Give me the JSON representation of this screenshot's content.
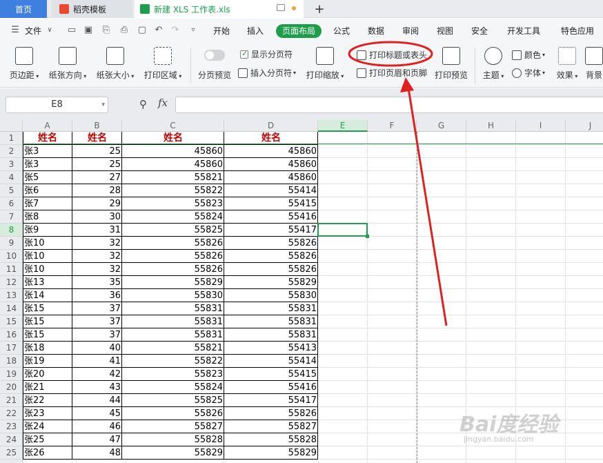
{
  "tabs": {
    "home": "首页",
    "docer": "稻壳模板",
    "file": "新建 XLS 工作表.xls",
    "add": "+"
  },
  "menu": {
    "file": "文件",
    "items": [
      "开始",
      "插入",
      "页面布局",
      "公式",
      "数据",
      "审阅",
      "视图",
      "安全",
      "开发工具",
      "特色应用"
    ],
    "active_index": 2
  },
  "ribbon": {
    "margins": "页边距",
    "orientation": "纸张方向",
    "size": "纸张大小",
    "print_area": "打印区域",
    "page_break_preview": "分页预览",
    "show_page_breaks": "显示分页符",
    "insert_page_break": "插入分页符",
    "print_scaling": "打印缩放",
    "print_titles": "打印标题或表头",
    "print_header_footer": "打印页眉和页脚",
    "print_preview": "打印预览",
    "theme": "主题",
    "colors": "颜色",
    "fonts": "字体",
    "effects": "效果",
    "background": "背景"
  },
  "formula_bar": {
    "cell_ref": "E8",
    "fx": "fx",
    "value": ""
  },
  "columns": [
    "A",
    "B",
    "C",
    "D",
    "E",
    "F",
    "G",
    "H",
    "I",
    "J"
  ],
  "active_column": "E",
  "active_row": 8,
  "header_row": [
    "姓名",
    "姓名",
    "姓名",
    "姓名"
  ],
  "rows": [
    [
      "张3",
      "25",
      "45860",
      "45860"
    ],
    [
      "张3",
      "25",
      "45860",
      "45860"
    ],
    [
      "张5",
      "27",
      "55821",
      "45860"
    ],
    [
      "张6",
      "28",
      "55822",
      "55414"
    ],
    [
      "张7",
      "29",
      "55823",
      "55415"
    ],
    [
      "张8",
      "30",
      "55824",
      "55416"
    ],
    [
      "张9",
      "31",
      "55825",
      "55417"
    ],
    [
      "张10",
      "32",
      "55826",
      "55826"
    ],
    [
      "张10",
      "32",
      "55826",
      "55826"
    ],
    [
      "张10",
      "32",
      "55826",
      "55826"
    ],
    [
      "张13",
      "35",
      "55829",
      "55829"
    ],
    [
      "张14",
      "36",
      "55830",
      "55830"
    ],
    [
      "张15",
      "37",
      "55831",
      "55831"
    ],
    [
      "张15",
      "37",
      "55831",
      "55831"
    ],
    [
      "张15",
      "37",
      "55831",
      "55831"
    ],
    [
      "张18",
      "40",
      "55821",
      "55413"
    ],
    [
      "张19",
      "41",
      "55822",
      "55414"
    ],
    [
      "张20",
      "42",
      "55823",
      "55415"
    ],
    [
      "张21",
      "43",
      "55824",
      "55416"
    ],
    [
      "张22",
      "44",
      "55825",
      "55417"
    ],
    [
      "张23",
      "45",
      "55826",
      "55826"
    ],
    [
      "张24",
      "46",
      "55827",
      "55827"
    ],
    [
      "张25",
      "47",
      "55828",
      "55828"
    ],
    [
      "张26",
      "48",
      "55829",
      "55829"
    ]
  ],
  "watermark": {
    "text": "Bai度经验",
    "sub": "jingyan.baidu.com"
  },
  "colors": {
    "accent": "#1e9d4c",
    "tab_home": "#3f7fe0",
    "header_text": "#c00000",
    "annotation": "#e02020"
  }
}
